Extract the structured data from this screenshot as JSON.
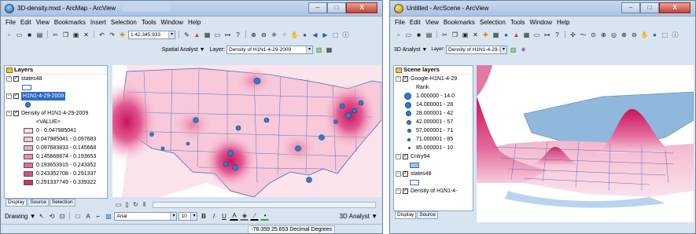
{
  "arcmap": {
    "title": "3D-density.mxd - ArcMap - ArcView",
    "caption_buttons": {
      "minimize": "–",
      "maximize": "□",
      "close": "X"
    },
    "menu": [
      "File",
      "Edit",
      "View",
      "Bookmarks",
      "Insert",
      "Selection",
      "Tools",
      "Window",
      "Help"
    ],
    "scale_value": "1:42,345,933",
    "spatial_analyst_label": "Spatial Analyst ▼",
    "layer_label": "Layer:",
    "layer_value": "Density of H1N1-4-29-2009",
    "toc": {
      "header": "Layers",
      "items": [
        {
          "label": "states48"
        },
        {
          "label": "H1N1-4-29-2009"
        },
        {
          "label": "Density of H1N1-4-29-2009"
        },
        {
          "label": "<VALUE>"
        },
        {
          "label": "0 - 0.047985041",
          "color": "#f8dbe7"
        },
        {
          "label": "0.047985041 - 0.097683",
          "color": "#f4c3d6"
        },
        {
          "label": "0.097683833 - 0.145668",
          "color": "#efa9c4"
        },
        {
          "label": "0.145668874 - 0.193653",
          "color": "#e88db0"
        },
        {
          "label": "0.193653915 - 0.243352",
          "color": "#e06e9a"
        },
        {
          "label": "0.243352708 - 0.291337",
          "color": "#d44f84"
        },
        {
          "label": "0.291337749 - 0.339322",
          "color": "#c7336f"
        }
      ],
      "tabs": [
        "Display",
        "Source",
        "Selection"
      ]
    },
    "drawing_label": "Drawing ▼",
    "font_name": "Arial",
    "font_size": "10",
    "bold": "B",
    "italic": "I",
    "underline": "U",
    "analyst3d_label": "3D Analyst ▼",
    "coordinates": "-76.359  25.653 Decimal Degrees"
  },
  "arcscene": {
    "title": "Untitled - ArcScene - ArcView",
    "caption_buttons": {
      "minimize": "–",
      "maximize": "□",
      "close": "X"
    },
    "menu": [
      "File",
      "Edit",
      "View",
      "Bookmarks",
      "Selection",
      "Tools",
      "Window",
      "Help"
    ],
    "analyst3d_label": "3D Analyst ▼",
    "layer_label": "Layer:",
    "layer_value": "Density of H1N1-4-29-2",
    "toc": {
      "header": "Scene layers",
      "items": [
        {
          "label": "Google-H1N1-4-29"
        },
        {
          "label": "Rank"
        },
        {
          "label": "1.000000 - 14.0"
        },
        {
          "label": "14.000001 - 28"
        },
        {
          "label": "28.000001 - 42"
        },
        {
          "label": "42.000001 - 57"
        },
        {
          "label": "57.000001 - 71"
        },
        {
          "label": "71.000001 - 85"
        },
        {
          "label": "85.000001 - 10"
        },
        {
          "label": "Cntry94"
        },
        {
          "label": "states48"
        },
        {
          "label": "Density of H1N1-4-"
        }
      ],
      "tabs": [
        "Display",
        "Source"
      ]
    }
  },
  "colors": {
    "window_bg": "#d9e4f1",
    "map_pink": "#f7c9da",
    "hotspot": "#d11a66",
    "state_line": "#4b67b7",
    "water": "#ffffff"
  }
}
